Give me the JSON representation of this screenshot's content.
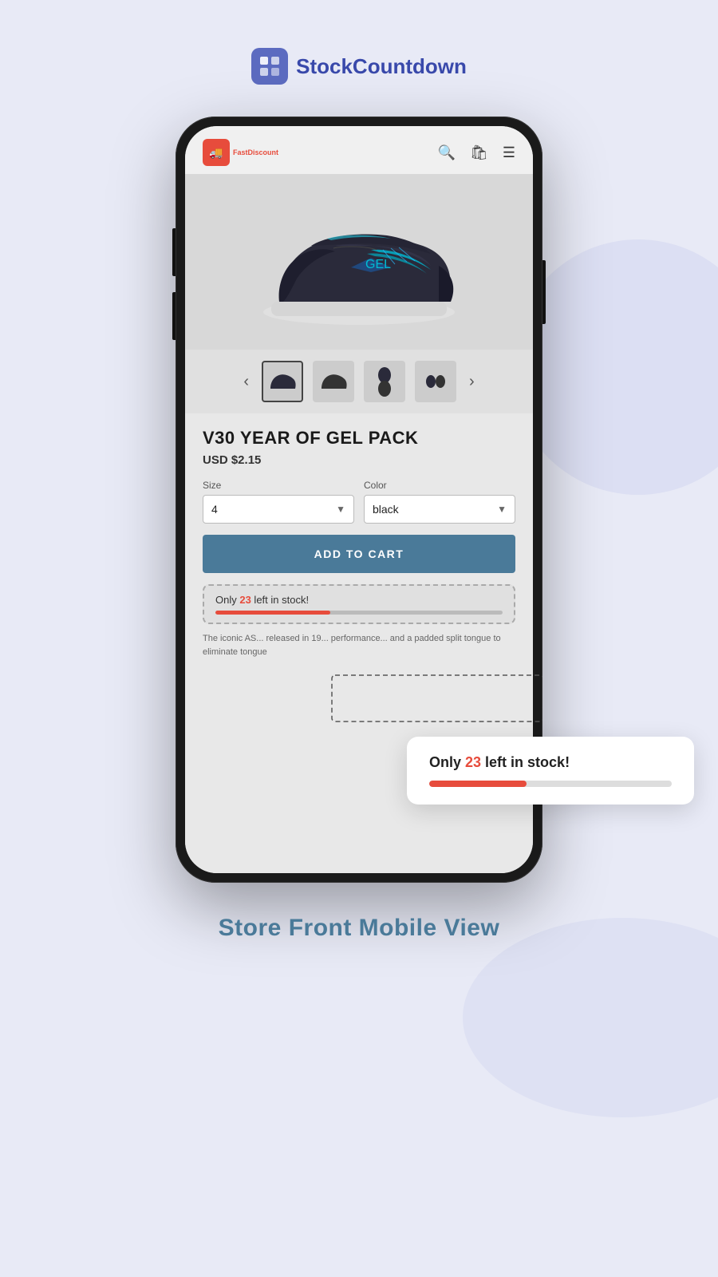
{
  "logo": {
    "text_plain": "Stock",
    "text_bold": "Countdown"
  },
  "nav": {
    "brand": "FastDiscount",
    "icons": [
      "search",
      "bag",
      "menu"
    ]
  },
  "product": {
    "name": "V30 YEAR OF GEL PACK",
    "price": "USD $2.15",
    "size_label": "Size",
    "size_value": "4",
    "color_label": "Color",
    "color_value": "black",
    "add_to_cart": "ADD TO CART",
    "description": "The iconic AS... released in 19... performance... and a padded split tongue to eliminate tongue"
  },
  "stock": {
    "text_before": "Only ",
    "count": "23",
    "text_after": " left in stock!",
    "bar_percent": 40
  },
  "thumbnails": [
    {
      "id": 1,
      "active": true
    },
    {
      "id": 2,
      "active": false
    },
    {
      "id": 3,
      "active": false
    },
    {
      "id": 4,
      "active": false
    }
  ],
  "footer": {
    "label": "Store Front Mobile View"
  }
}
